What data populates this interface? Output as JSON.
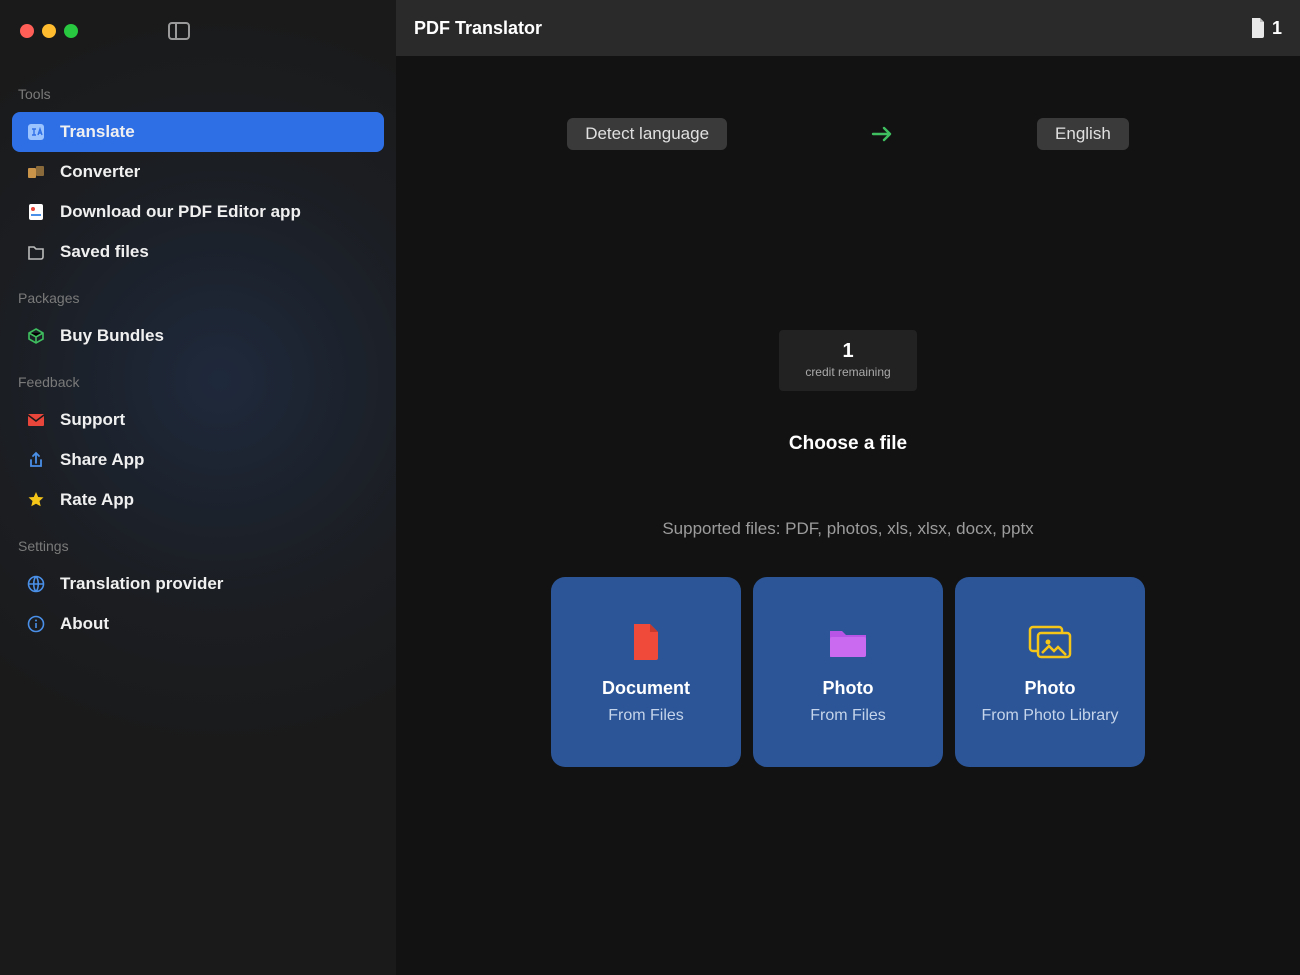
{
  "titlebar": {
    "title": "PDF Translator",
    "file_count": "1"
  },
  "sidebar": {
    "sections": {
      "tools": {
        "label": "Tools",
        "items": [
          {
            "label": "Translate"
          },
          {
            "label": "Converter"
          },
          {
            "label": "Download our PDF Editor app"
          },
          {
            "label": "Saved files"
          }
        ]
      },
      "packages": {
        "label": "Packages",
        "items": [
          {
            "label": "Buy Bundles"
          }
        ]
      },
      "feedback": {
        "label": "Feedback",
        "items": [
          {
            "label": "Support"
          },
          {
            "label": "Share App"
          },
          {
            "label": "Rate App"
          }
        ]
      },
      "settings": {
        "label": "Settings",
        "items": [
          {
            "label": "Translation provider"
          },
          {
            "label": "About"
          }
        ]
      }
    }
  },
  "lang": {
    "source": "Detect language",
    "target": "English"
  },
  "credit": {
    "value": "1",
    "label": "credit remaining"
  },
  "choose": {
    "title": "Choose a file",
    "supported": "Supported files: PDF, photos, xls, xlsx, docx, pptx"
  },
  "cards": [
    {
      "title": "Document",
      "sub": "From Files"
    },
    {
      "title": "Photo",
      "sub": "From Files"
    },
    {
      "title": "Photo",
      "sub": "From Photo Library"
    }
  ]
}
